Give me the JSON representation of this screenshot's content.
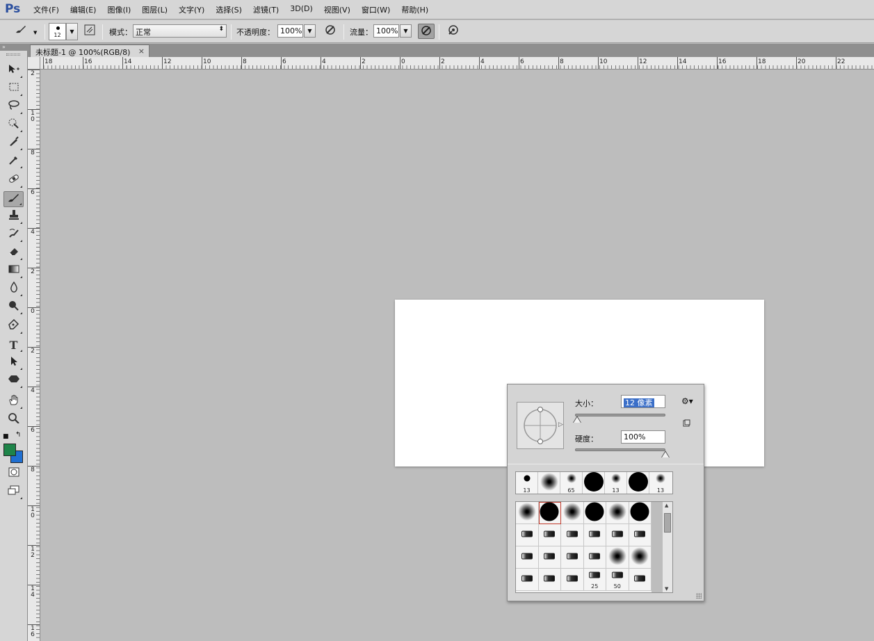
{
  "app": {
    "logo": "Ps"
  },
  "menu": [
    "文件(F)",
    "编辑(E)",
    "图像(I)",
    "图层(L)",
    "文字(Y)",
    "选择(S)",
    "滤镜(T)",
    "3D(D)",
    "视图(V)",
    "窗口(W)",
    "帮助(H)"
  ],
  "options": {
    "brush_size": "12",
    "mode_label": "模式：",
    "mode_value": "正常",
    "opacity_label": "不透明度：",
    "opacity_value": "100%",
    "flow_label": "流量：",
    "flow_value": "100%"
  },
  "document": {
    "tab_title": "未标题-1 @ 100%(RGB/8)",
    "close": "×"
  },
  "ruler_top": [
    "18",
    "16",
    "14",
    "12",
    "10",
    "8",
    "6",
    "4",
    "2",
    "0",
    "2",
    "4",
    "6",
    "8",
    "10",
    "12",
    "14",
    "16",
    "18",
    "20",
    "22"
  ],
  "ruler_left": [
    "2",
    "1\n0",
    "8",
    "6",
    "4",
    "2",
    "0",
    "2",
    "4",
    "6",
    "8",
    "1\n0",
    "1\n2",
    "1\n4",
    "1\n6"
  ],
  "colors": {
    "foreground": "#1e8449",
    "background": "#1f6fd1"
  },
  "brush_popup": {
    "size_label": "大小：",
    "size_value": "12 像素",
    "hardness_label": "硬度：",
    "hardness_value": "100%",
    "size_fraction": 0.02,
    "hardness_fraction": 1.0,
    "recent_brushes": [
      {
        "label": "13",
        "kind": "hard"
      },
      {
        "label": "",
        "kind": "soft"
      },
      {
        "label": "65",
        "kind": "soft"
      },
      {
        "label": "",
        "kind": "hard"
      },
      {
        "label": "13",
        "kind": "soft"
      },
      {
        "label": "",
        "kind": "hard"
      },
      {
        "label": "13",
        "kind": "soft"
      }
    ],
    "preset_brushes": [
      {
        "label": "",
        "kind": "soft"
      },
      {
        "label": "",
        "kind": "hard"
      },
      {
        "label": "",
        "kind": "soft"
      },
      {
        "label": "",
        "kind": "hard"
      },
      {
        "label": "",
        "kind": "soft"
      },
      {
        "label": "",
        "kind": "hard"
      },
      {
        "label": "",
        "kind": "tip"
      },
      {
        "label": "",
        "kind": "tip"
      },
      {
        "label": "",
        "kind": "tip"
      },
      {
        "label": "",
        "kind": "tip"
      },
      {
        "label": "",
        "kind": "tip"
      },
      {
        "label": "",
        "kind": "tip"
      },
      {
        "label": "",
        "kind": "tip"
      },
      {
        "label": "",
        "kind": "tip"
      },
      {
        "label": "",
        "kind": "tip"
      },
      {
        "label": "",
        "kind": "tip"
      },
      {
        "label": "",
        "kind": "soft"
      },
      {
        "label": "",
        "kind": "soft"
      },
      {
        "label": "",
        "kind": "tip"
      },
      {
        "label": "",
        "kind": "tip"
      },
      {
        "label": "",
        "kind": "tip"
      },
      {
        "label": "25",
        "kind": "tip"
      },
      {
        "label": "50",
        "kind": "tip"
      },
      {
        "label": "",
        "kind": "tip"
      }
    ]
  }
}
